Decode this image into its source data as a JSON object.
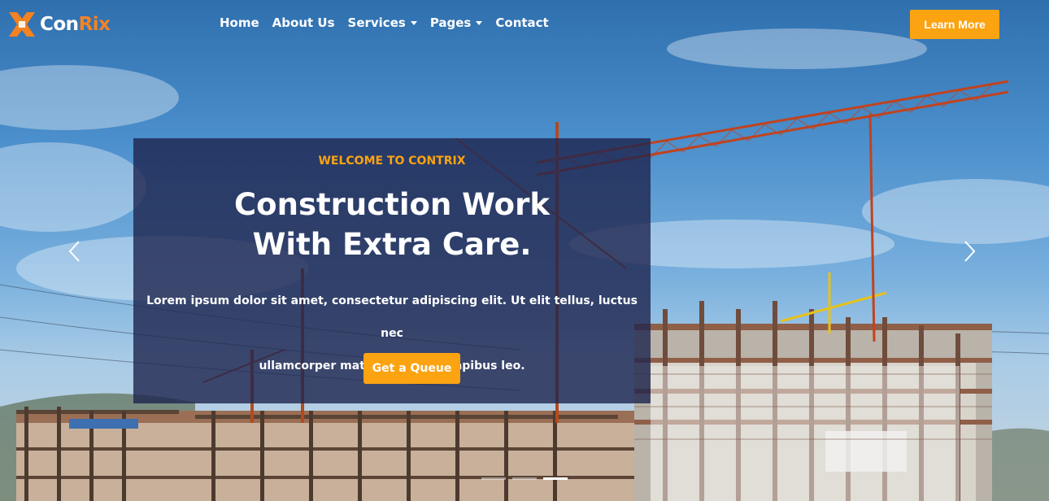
{
  "brand": {
    "name_part1": "Con",
    "name_part2": "Rix",
    "icon": "conrix-logo-icon"
  },
  "nav": {
    "items": [
      {
        "label": "Home",
        "has_dropdown": false
      },
      {
        "label": "About Us",
        "has_dropdown": false
      },
      {
        "label": "Services",
        "has_dropdown": true
      },
      {
        "label": "Pages",
        "has_dropdown": true
      },
      {
        "label": "Contact",
        "has_dropdown": false
      }
    ],
    "cta_label": "Learn More"
  },
  "hero": {
    "eyebrow": "WELCOME TO CONTRIX",
    "headline_line1": "Construction Work",
    "headline_line2": "With Extra Care.",
    "lead_line1": "Lorem ipsum dolor sit amet, consectetur adipiscing elit. Ut elit tellus, luctus nec",
    "lead_line2": "ullamcorper mattis, pulvinar dapibus leo.",
    "button_label": "Get a Queue",
    "background_image": "construction site with cranes"
  },
  "carousel": {
    "slide_count": 3,
    "active_index": 2,
    "prev_icon": "chevron-left-icon",
    "next_icon": "chevron-right-icon"
  },
  "colors": {
    "accent": "#fca311",
    "logo_orange": "#f58220",
    "panel": "#1e244e"
  }
}
